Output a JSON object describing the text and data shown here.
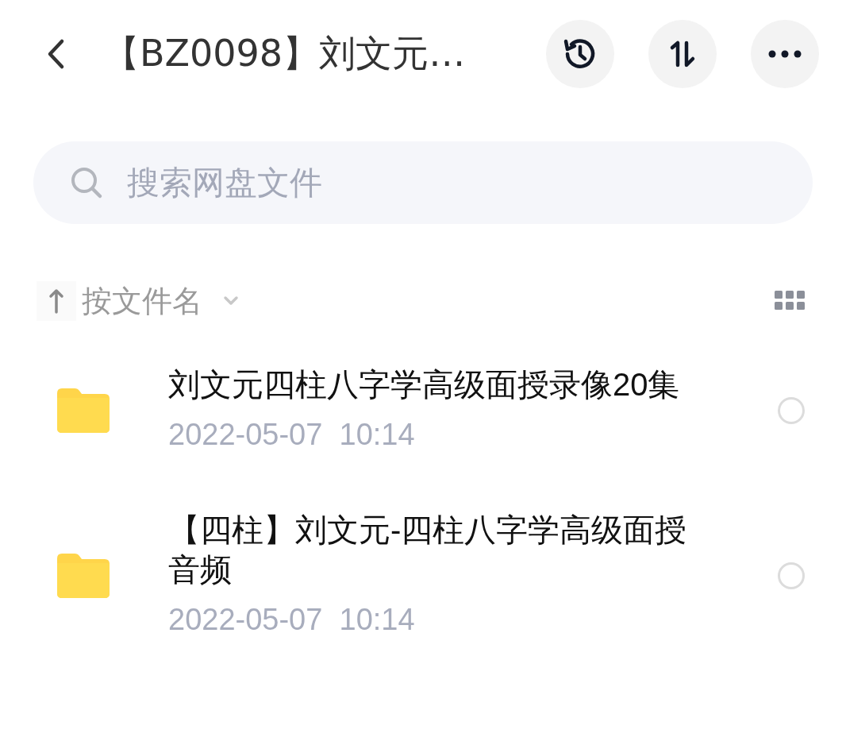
{
  "header": {
    "title": "【BZ0098】刘文元…"
  },
  "search": {
    "placeholder": "搜索网盘文件"
  },
  "sort": {
    "label": "按文件名"
  },
  "files": [
    {
      "name": "刘文元四柱八字学高级面授录像20集",
      "date": "2022-05-07  10:14",
      "selected": false
    },
    {
      "name": "【四柱】刘文元-四柱八字学高级面授音频",
      "date": "2022-05-07  10:14",
      "selected": false
    }
  ]
}
